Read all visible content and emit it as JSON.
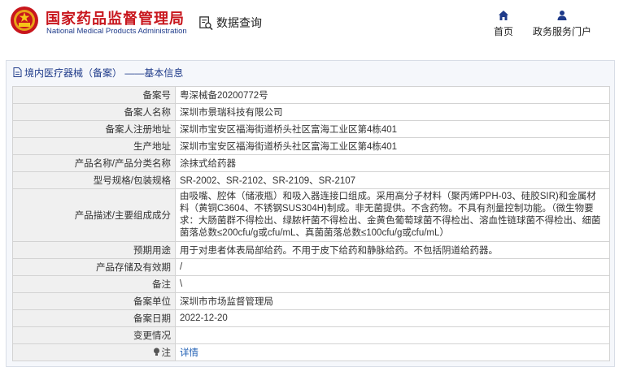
{
  "header": {
    "brand_cn": "国家药品监督管理局",
    "brand_en": "National Medical Products Administration",
    "search_label": "数据查询",
    "nav": [
      {
        "label": "首页",
        "icon": "home-icon"
      },
      {
        "label": "政务服务门户",
        "icon": "user-icon"
      }
    ]
  },
  "panel": {
    "title": "境内医疗器械（备案） ——基本信息",
    "rows": [
      {
        "label": "备案号",
        "value": "粤深械备20200772号"
      },
      {
        "label": "备案人名称",
        "value": "深圳市景瑞科技有限公司"
      },
      {
        "label": "备案人注册地址",
        "value": "深圳市宝安区福海街道桥头社区富海工业区第4栋401"
      },
      {
        "label": "生产地址",
        "value": "深圳市宝安区福海街道桥头社区富海工业区第4栋401"
      },
      {
        "label": "产品名称/产品分类名称",
        "value": "涂抹式给药器"
      },
      {
        "label": "型号规格/包装规格",
        "value": "SR-2002、SR-2102、SR-2109、SR-2107"
      },
      {
        "label": "产品描述/主要组成成分",
        "value": "由吸嘴、腔体（储液瓶）和吸入器连接口组成。采用高分子材料（聚丙烯PPH-03、硅胶SIR)和金属材料（黄铜C3604、不锈钢SUS304H)制成。非无菌提供。不含药物。不具有剂量控制功能。（微生物要求：大肠菌群不得检出、绿脓杆菌不得检出、金黄色葡萄球菌不得检出、溶血性链球菌不得检出、细菌菌落总数≤200cfu/g或cfu/mL、真菌菌落总数≤100cfu/g或cfu/mL）"
      },
      {
        "label": "预期用途",
        "value": "用于对患者体表局部给药。不用于皮下给药和静脉给药。不包括阴道给药器。"
      },
      {
        "label": "产品存储及有效期",
        "value": "/"
      },
      {
        "label": "备注",
        "value": "\\"
      },
      {
        "label": "备案单位",
        "value": "深圳市市场监督管理局"
      },
      {
        "label": "备案日期",
        "value": "2022-12-20"
      },
      {
        "label": "变更情况",
        "value": ""
      }
    ],
    "note": {
      "label": "注",
      "link": "详情",
      "icon": "bulb-icon"
    }
  },
  "colors": {
    "brand_red": "#c8161d",
    "brand_blue": "#1f3b8a",
    "link_blue": "#1f5fb4"
  }
}
